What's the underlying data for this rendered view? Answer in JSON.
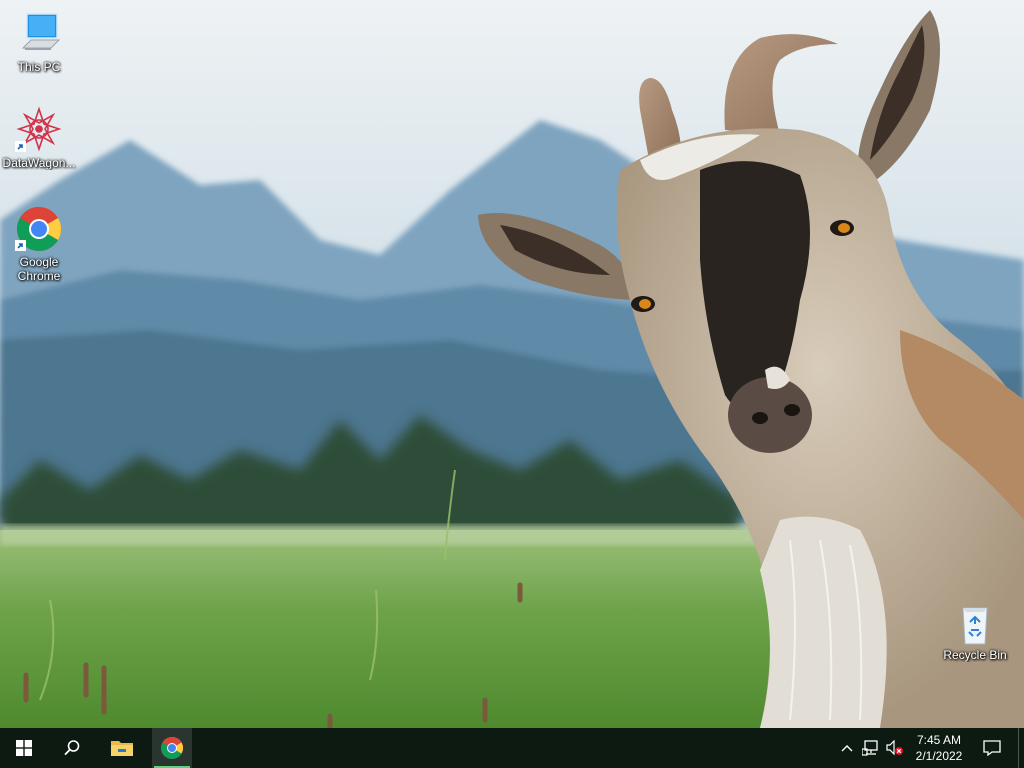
{
  "desktop": {
    "wallpaper": "goat-meadow-mountains",
    "icons": [
      {
        "name": "this-pc",
        "label": "This PC",
        "icon": "monitor-icon"
      },
      {
        "name": "datawagon",
        "label": "DataWagon...",
        "icon": "mandala-logo-icon"
      },
      {
        "name": "google-chrome",
        "label": "Google Chrome",
        "icon": "chrome-icon"
      },
      {
        "name": "recycle-bin",
        "label": "Recycle Bin",
        "icon": "recycle-bin-icon"
      }
    ]
  },
  "taskbar": {
    "start": "windows-logo-icon",
    "search": "search-icon",
    "pinned": [
      {
        "name": "file-explorer",
        "icon": "folder-icon",
        "active": false
      },
      {
        "name": "chrome",
        "icon": "chrome-icon",
        "active": true
      }
    ],
    "tray": {
      "chevron": "chevron-up-icon",
      "network": "network-icon",
      "volume": "volume-muted-icon",
      "time": "7:45 AM",
      "date": "2/1/2022",
      "notifications": "notification-icon"
    },
    "colors": {
      "background": "#0c1a12",
      "active_indicator": "#5fd07e"
    }
  }
}
